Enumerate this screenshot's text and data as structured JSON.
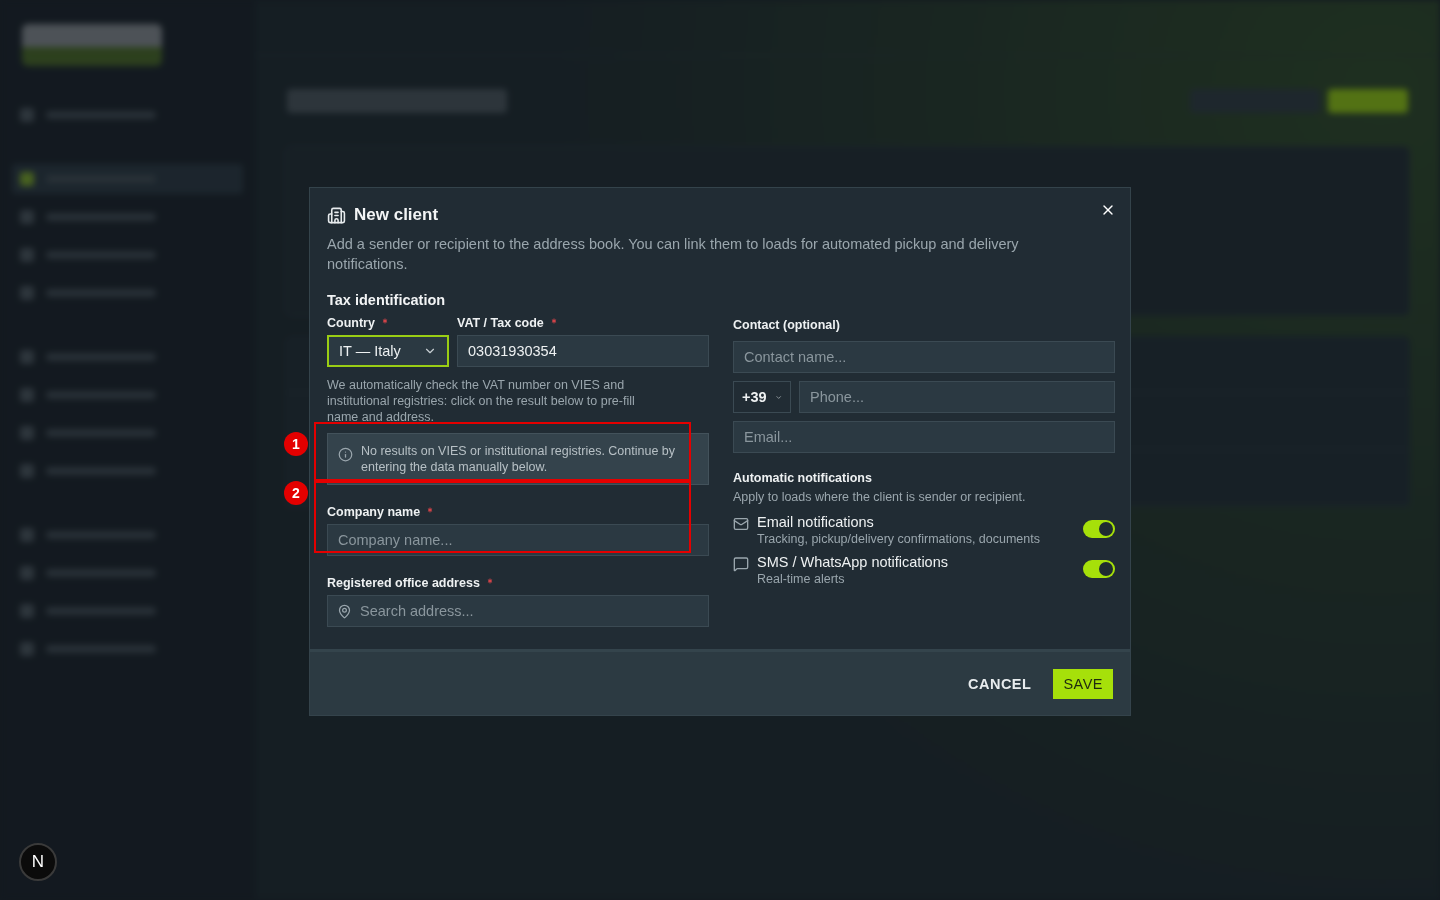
{
  "backdrop": {
    "sidebar_groups": [
      {
        "items": [
          {
            "selected": false
          }
        ]
      },
      {
        "items": [
          {
            "selected": true
          },
          {
            "selected": false
          },
          {
            "selected": false
          },
          {
            "selected": false
          }
        ]
      },
      {
        "items": [
          {
            "selected": false
          },
          {
            "selected": false
          },
          {
            "selected": false
          },
          {
            "selected": false
          }
        ]
      },
      {
        "items": [
          {
            "selected": false
          },
          {
            "selected": false
          },
          {
            "selected": false
          },
          {
            "selected": false
          }
        ]
      }
    ]
  },
  "dev_badge": "N",
  "dialog": {
    "title": "New client",
    "description": "Add a sender or recipient to the address book. You can link them to loads for automated pickup and delivery notifications.",
    "tax": {
      "heading": "Tax identification",
      "country": {
        "label": "Country",
        "required": true,
        "value": "IT — Italy",
        "focused": true
      },
      "vat": {
        "label": "VAT / Tax code",
        "required": true,
        "value": "03031930354"
      },
      "help": "We automatically check the VAT number on VIES and institutional registries: click on the result below to pre-fill name and address.",
      "notice": "No results on VIES or institutional registries. Continue by entering the data manually below."
    },
    "company": {
      "label": "Company name",
      "required": true,
      "placeholder": "Company name..."
    },
    "address": {
      "label": "Registered office address",
      "required": true,
      "placeholder": "Search address..."
    },
    "contact": {
      "label": "Contact (optional)",
      "name_placeholder": "Contact name...",
      "phone_prefix": "+39",
      "phone_placeholder": "Phone...",
      "email_placeholder": "Email..."
    },
    "notifications": {
      "heading": "Automatic notifications",
      "subheading": "Apply to loads where the client is sender or recipient.",
      "items": [
        {
          "kind": "email",
          "title": "Email notifications",
          "subtitle": "Tracking, pickup/delivery confirmations, documents",
          "on": true
        },
        {
          "kind": "message",
          "title": "SMS / WhatsApp notifications",
          "subtitle": "Real-time alerts",
          "on": true
        }
      ]
    },
    "buttons": {
      "cancel": "CANCEL",
      "save": "SAVE"
    }
  },
  "annotations": [
    {
      "label": "1"
    },
    {
      "label": "2"
    }
  ]
}
